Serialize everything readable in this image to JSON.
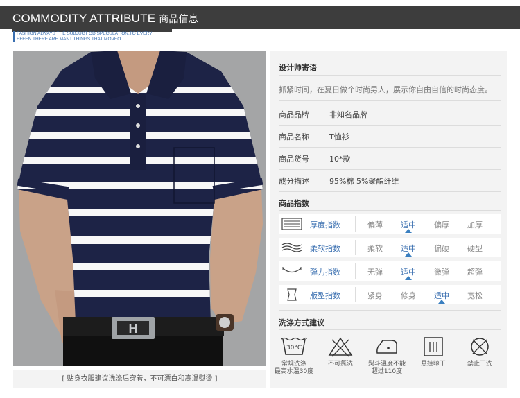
{
  "header": {
    "title_en": "COMMODITY ATTRIBUTE",
    "title_cn": "商品信息",
    "tagline_line1": "FASHION ALWAYS THE  SUBJUCT OD SPECULATION,TO EVERY",
    "tagline_line2": "EFFEN THERE ARE MANT THINGS THAT MOVEO."
  },
  "photo": {
    "caption": "[  贴身衣服建议洗涤后穿着，不可漂白和高温熨烫  ]"
  },
  "designer": {
    "title": "设计师寄语",
    "text": "抓紧时间，在夏日做个时尚男人，展示你自由自信的时尚态度。"
  },
  "info": [
    {
      "label": "商品品牌",
      "value": "非知名品牌"
    },
    {
      "label": "商品名称",
      "value": "T恤衫"
    },
    {
      "label": "商品货号",
      "value": "10*款"
    },
    {
      "label": "成分描述",
      "value": "95%棉  5%聚酯纤维"
    }
  ],
  "indices": {
    "title": "商品指数",
    "rows": [
      {
        "label": "厚度指数",
        "icon": "thickness-icon",
        "options": [
          "偏薄",
          "适中",
          "偏厚",
          "加厚"
        ],
        "selected": 1
      },
      {
        "label": "柔软指数",
        "icon": "softness-icon",
        "options": [
          "柔软",
          "适中",
          "偏硬",
          "硬型"
        ],
        "selected": 1
      },
      {
        "label": "弹力指数",
        "icon": "elasticity-icon",
        "options": [
          "无弹",
          "适中",
          "微弹",
          "超弹"
        ],
        "selected": 1
      },
      {
        "label": "版型指数",
        "icon": "fit-icon",
        "options": [
          "紧身",
          "修身",
          "适中",
          "宽松"
        ],
        "selected": 2
      }
    ]
  },
  "washing": {
    "title": "洗涤方式建议",
    "items": [
      {
        "icon": "wash-30-icon",
        "icon_text": "30°C",
        "label1": "常规洗涤",
        "label2": "最高水温30度"
      },
      {
        "icon": "no-bleach-icon",
        "label1": "不可氯洗",
        "label2": ""
      },
      {
        "icon": "iron-icon",
        "label1": "熨斗温度不能",
        "label2": "超过110度"
      },
      {
        "icon": "hang-dry-icon",
        "label1": "悬挂晾干",
        "label2": ""
      },
      {
        "icon": "no-dry-clean-icon",
        "label1": "禁止干洗",
        "label2": ""
      }
    ]
  }
}
